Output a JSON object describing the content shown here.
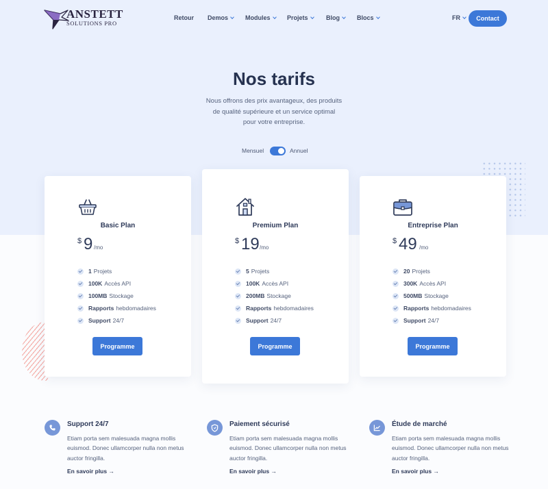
{
  "header": {
    "logo_line1": "ANSTETT",
    "logo_line2": "SOLUTIONS PRO",
    "nav": [
      "Retour",
      "Demos",
      "Modules",
      "Projets",
      "Blog",
      "Blocs"
    ],
    "language": "FR",
    "contact_label": "Contact"
  },
  "hero": {
    "title": "Nos tarifs",
    "subtitle": "Nous offrons des prix avantageux, des produits de qualité supérieure et un service optimal pour votre entreprise."
  },
  "billing": {
    "monthly_label": "Mensuel",
    "yearly_label": "Annuel"
  },
  "plans": [
    {
      "name": "Basic Plan",
      "currency": "$",
      "price": "9",
      "period": "/mo",
      "icon": "basket-icon",
      "features": [
        {
          "strong": "1",
          "text": "Projets"
        },
        {
          "strong": "100K",
          "text": "Accès API"
        },
        {
          "strong": "100MB",
          "text": "Stockage"
        },
        {
          "strong": "Rapports",
          "text": "hebdomadaires"
        },
        {
          "strong": "Support",
          "text": "24/7"
        }
      ],
      "button": "Programme"
    },
    {
      "name": "Premium Plan",
      "currency": "$",
      "price": "19",
      "period": "/mo",
      "icon": "house-icon",
      "features": [
        {
          "strong": "5",
          "text": "Projets"
        },
        {
          "strong": "100K",
          "text": "Accès API"
        },
        {
          "strong": "200MB",
          "text": "Stockage"
        },
        {
          "strong": "Rapports",
          "text": "hebdomadaires"
        },
        {
          "strong": "Support",
          "text": "24/7"
        }
      ],
      "button": "Programme"
    },
    {
      "name": "Entreprise Plan",
      "currency": "$",
      "price": "49",
      "period": "/mo",
      "icon": "briefcase-icon",
      "features": [
        {
          "strong": "20",
          "text": "Projets"
        },
        {
          "strong": "300K",
          "text": "Accès API"
        },
        {
          "strong": "500MB",
          "text": "Stockage"
        },
        {
          "strong": "Rapports",
          "text": "hebdomadaires"
        },
        {
          "strong": "Support",
          "text": "24/7"
        }
      ],
      "button": "Programme"
    }
  ],
  "features": [
    {
      "title": "Support 24/7",
      "icon": "phone-icon",
      "description": "Etiam porta sem malesuada magna mollis euismod. Donec ullamcorper nulla non metus auctor fringilla.",
      "link": "En savoir plus →"
    },
    {
      "title": "Paiement sécurisé",
      "icon": "shield-icon",
      "description": "Etiam porta sem malesuada magna mollis euismod. Donec ullamcorper nulla non metus auctor fringilla.",
      "link": "En savoir plus →"
    },
    {
      "title": "Étude de marché",
      "icon": "chart-icon",
      "description": "Etiam porta sem malesuada magna mollis euismod. Donec ullamcorper nulla non metus auctor fringilla.",
      "link": "En savoir plus →"
    }
  ],
  "colors": {
    "accent": "#3c78d8",
    "hero_bg": "#eaf0fd",
    "text_dark": "#2e3a59"
  }
}
